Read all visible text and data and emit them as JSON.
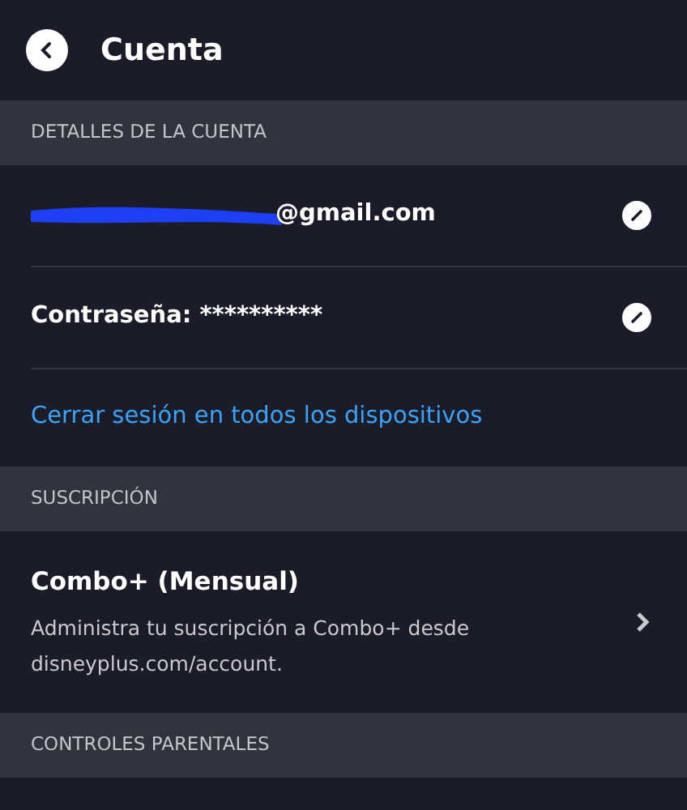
{
  "header": {
    "title": "Cuenta"
  },
  "sections": [
    {
      "heading": "DETALLES DE LA CUENTA",
      "rows": [
        {
          "kind": "redacted",
          "text": "@gmail.com"
        },
        {
          "kind": "editable",
          "text": "Contraseña: **********"
        },
        {
          "kind": "link",
          "text": "Cerrar sesión en todos los dispositivos"
        }
      ]
    },
    {
      "heading": "SUSCRIPCIÓN",
      "rows": [
        {
          "kind": "detail",
          "text": "Combo+ (Mensual)",
          "description": "Administra tu suscripción a Combo+ desde disneyplus.com/account."
        }
      ]
    },
    {
      "heading": "CONTROLES PARENTALES"
    }
  ]
}
